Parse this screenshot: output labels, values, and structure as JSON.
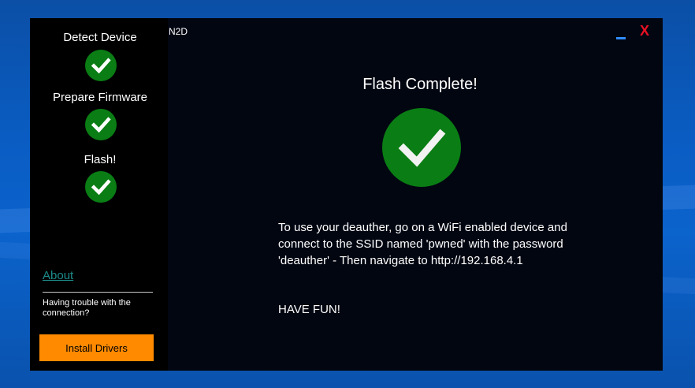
{
  "window": {
    "title": "N2D",
    "minimize_label": "–",
    "close_label": "X"
  },
  "sidebar": {
    "steps": [
      {
        "label": "Detect Device",
        "status": "complete"
      },
      {
        "label": "Prepare Firmware",
        "status": "complete"
      },
      {
        "label": "Flash!",
        "status": "complete"
      }
    ],
    "about_label": "About",
    "trouble_text": "Having trouble with the connection?",
    "install_drivers_label": "Install Drivers"
  },
  "main": {
    "title": "Flash Complete!",
    "instructions": "To use your deauther, go on a WiFi enabled device and connect to the SSID named 'pwned' with the password 'deauther' - Then navigate to http://192.168.4.1",
    "have_fun": "HAVE FUN!"
  },
  "colors": {
    "success_green": "#0a7d14",
    "install_button_orange": "#ff8a00",
    "link_teal": "#1d8b8b",
    "close_red": "#e81123",
    "minimize_blue": "#2f8cff"
  },
  "icons": {
    "step_status": "check-circle-icon",
    "main_status": "check-circle-icon"
  }
}
